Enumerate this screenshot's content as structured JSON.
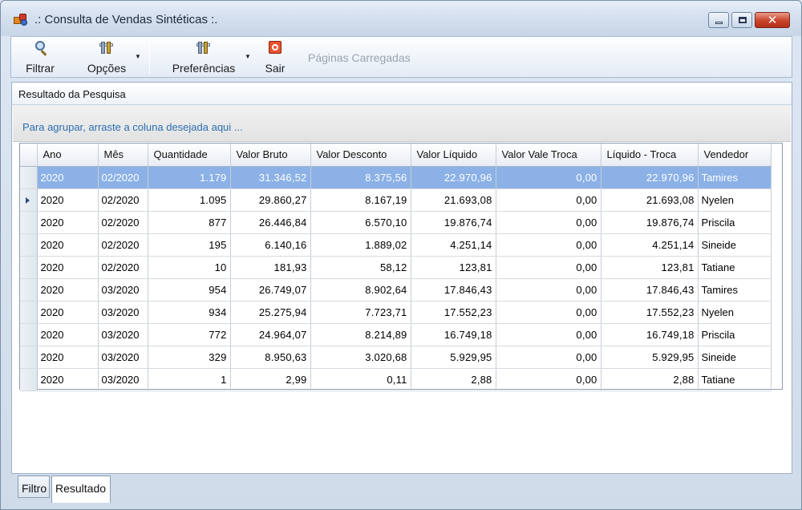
{
  "window": {
    "title": ".: Consulta de Vendas Sintéticas :.",
    "icon": "app-icon",
    "controls": [
      "minimize-icon",
      "maximize-icon",
      "close-icon"
    ]
  },
  "toolbar": {
    "filtrar": {
      "label": "Filtrar",
      "icon": "magnify-icon"
    },
    "opcoes": {
      "label": "Opções",
      "icon": "tools-icon"
    },
    "preferencias": {
      "label": "Preferências",
      "icon": "tools-icon"
    },
    "sair": {
      "label": "Sair",
      "icon": "exit-icon"
    },
    "paginas": {
      "label": "Páginas Carregadas"
    }
  },
  "panel": {
    "title": "Resultado da Pesquisa",
    "group_hint": "Para agrupar, arraste a coluna desejada aqui ..."
  },
  "grid": {
    "columns": [
      "Ano",
      "Mês",
      "Quantidade",
      "Valor Bruto",
      "Valor Desconto",
      "Valor Líquido",
      "Valor Vale Troca",
      "Líquido - Troca",
      "Vendedor"
    ],
    "selected_row": 0,
    "current_row": 1,
    "rows": [
      [
        "2020",
        "02/2020",
        "1.179",
        "31.346,52",
        "8.375,56",
        "22.970,96",
        "0,00",
        "22.970,96",
        "Tamires"
      ],
      [
        "2020",
        "02/2020",
        "1.095",
        "29.860,27",
        "8.167,19",
        "21.693,08",
        "0,00",
        "21.693,08",
        "Nyelen"
      ],
      [
        "2020",
        "02/2020",
        "877",
        "26.446,84",
        "6.570,10",
        "19.876,74",
        "0,00",
        "19.876,74",
        "Priscila"
      ],
      [
        "2020",
        "02/2020",
        "195",
        "6.140,16",
        "1.889,02",
        "4.251,14",
        "0,00",
        "4.251,14",
        "Sineide"
      ],
      [
        "2020",
        "02/2020",
        "10",
        "181,93",
        "58,12",
        "123,81",
        "0,00",
        "123,81",
        "Tatiane"
      ],
      [
        "2020",
        "03/2020",
        "954",
        "26.749,07",
        "8.902,64",
        "17.846,43",
        "0,00",
        "17.846,43",
        "Tamires"
      ],
      [
        "2020",
        "03/2020",
        "934",
        "25.275,94",
        "7.723,71",
        "17.552,23",
        "0,00",
        "17.552,23",
        "Nyelen"
      ],
      [
        "2020",
        "03/2020",
        "772",
        "24.964,07",
        "8.214,89",
        "16.749,18",
        "0,00",
        "16.749,18",
        "Priscila"
      ],
      [
        "2020",
        "03/2020",
        "329",
        "8.950,63",
        "3.020,68",
        "5.929,95",
        "0,00",
        "5.929,95",
        "Sineide"
      ],
      [
        "2020",
        "03/2020",
        "1",
        "2,99",
        "0,11",
        "2,88",
        "0,00",
        "2,88",
        "Tatiane"
      ]
    ]
  },
  "tabs": [
    {
      "label": "Filtro",
      "active": false
    },
    {
      "label": "Resultado",
      "active": true
    }
  ],
  "colors": {
    "selection": "#8bb1e6",
    "group_hint_text": "#2d6fb0",
    "close_button": "#c8432b"
  }
}
